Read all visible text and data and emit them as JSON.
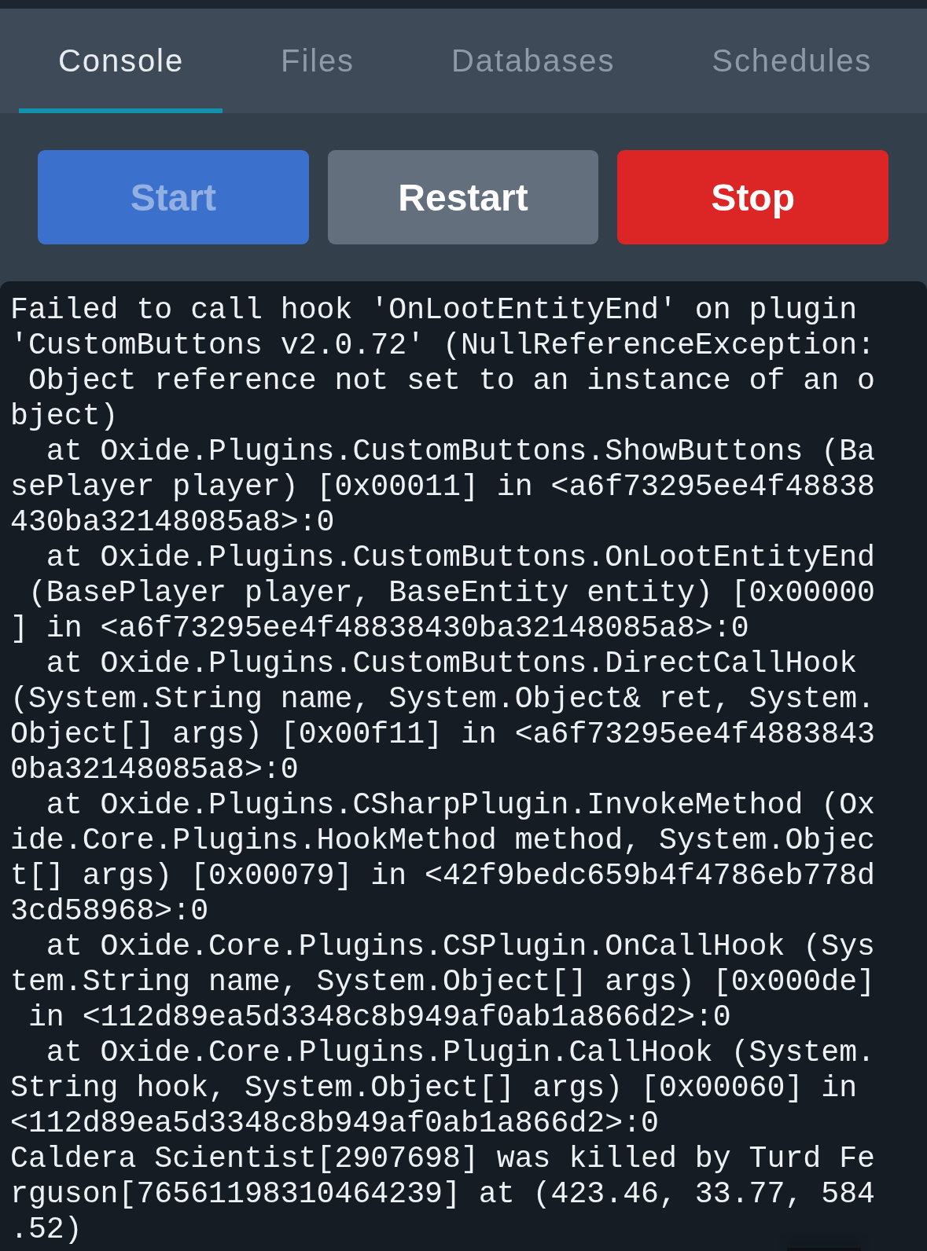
{
  "tabs": [
    {
      "label": "Console",
      "selected": true
    },
    {
      "label": "Files",
      "selected": false
    },
    {
      "label": "Databases",
      "selected": false
    },
    {
      "label": "Schedules",
      "selected": false
    }
  ],
  "actions": [
    {
      "label": "Start",
      "kind": "primary",
      "disabled": true
    },
    {
      "label": "Restart",
      "kind": "secondary",
      "disabled": false
    },
    {
      "label": "Stop",
      "kind": "danger",
      "disabled": false
    }
  ],
  "console": {
    "lines": [
      "Failed to call hook 'OnLootEntityEnd' on plugin 'CustomButtons v2.0.72' (NullReferenceException: Object reference not set to an instance of an object)",
      "  at Oxide.Plugins.CustomButtons.ShowButtons (BasePlayer player) [0x00011] in <a6f73295ee4f48838430ba32148085a8>:0",
      "  at Oxide.Plugins.CustomButtons.OnLootEntityEnd (BasePlayer player, BaseEntity entity) [0x00000] in <a6f73295ee4f48838430ba32148085a8>:0",
      "  at Oxide.Plugins.CustomButtons.DirectCallHook (System.String name, System.Object& ret, System.Object[] args) [0x00f11] in <a6f73295ee4f48838430ba32148085a8>:0",
      "  at Oxide.Plugins.CSharpPlugin.InvokeMethod (Oxide.Core.Plugins.HookMethod method, System.Object[] args) [0x00079] in <42f9bedc659b4f4786eb778d3cd58968>:0",
      "  at Oxide.Core.Plugins.CSPlugin.OnCallHook (System.String name, System.Object[] args) [0x000de] in <112d89ea5d3348c8b949af0ab1a866d2>:0",
      "  at Oxide.Core.Plugins.Plugin.CallHook (System.String hook, System.Object[] args) [0x00060] in <112d89ea5d3348c8b949af0ab1a866d2>:0",
      "Caldera Scientist[2907698] was killed by Turd Ferguson[76561198310464239] at (423.46, 33.77, 584.52)"
    ]
  }
}
